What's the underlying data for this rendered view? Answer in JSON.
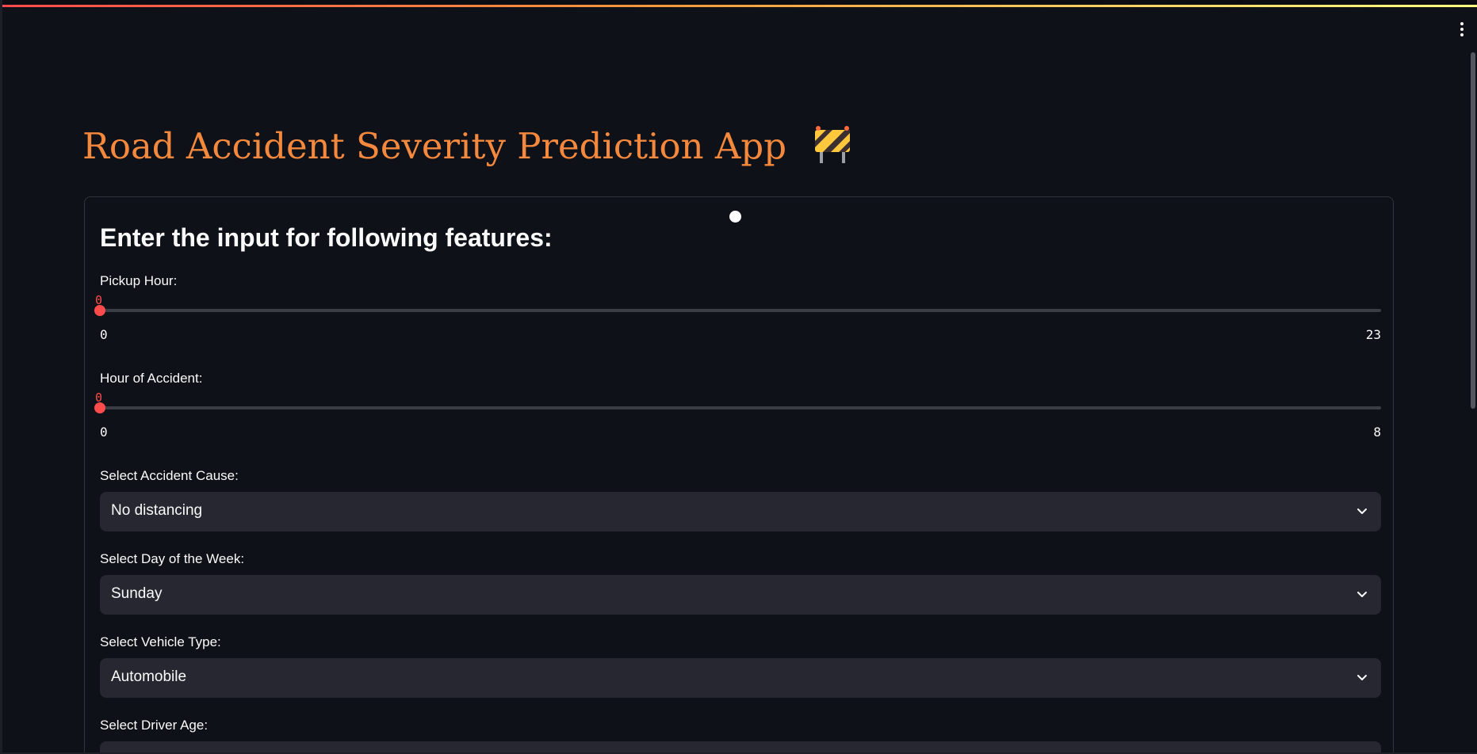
{
  "app": {
    "title": "Road Accident Severity Prediction App"
  },
  "form": {
    "heading": "Enter the input for following features:",
    "sliders": [
      {
        "label": "Pickup Hour:",
        "value": "0",
        "min": "0",
        "max": "23"
      },
      {
        "label": "Hour of Accident:",
        "value": "0",
        "min": "0",
        "max": "8"
      }
    ],
    "selects": [
      {
        "label": "Select Accident Cause:",
        "value": "No distancing"
      },
      {
        "label": "Select Day of the Week:",
        "value": "Sunday"
      },
      {
        "label": "Select Vehicle Type:",
        "value": "Automobile"
      },
      {
        "label": "Select Driver Age:",
        "value": ""
      }
    ]
  },
  "icons": {
    "title_emoji": "construction-barrier-icon",
    "menu": "kebab-menu-icon",
    "select_chevron": "chevron-down-icon",
    "status": "running-status-icon"
  },
  "colors": {
    "background": "#0e1117",
    "title": "#f4883d",
    "accent": "#ff4b4b",
    "select_bg": "#262730",
    "text": "#fafafa"
  }
}
